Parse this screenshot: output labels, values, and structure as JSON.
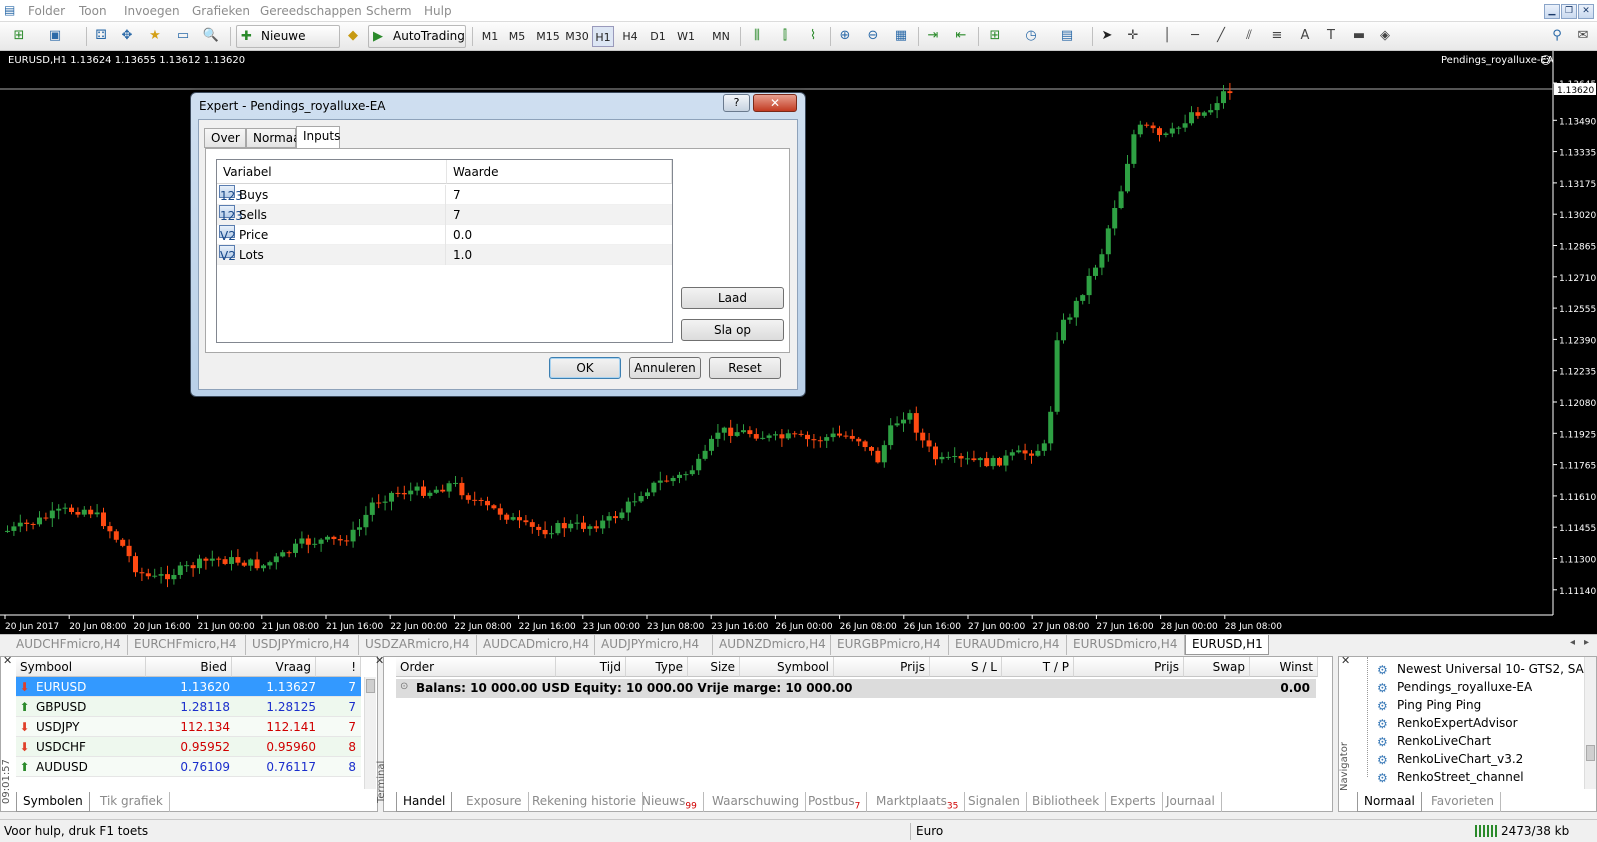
{
  "menu": [
    "Folder",
    "Toon",
    "Invoegen",
    "Grafieken",
    "Gereedschappen",
    "Scherm",
    "Hulp"
  ],
  "toolbar": {
    "new_order": "Nieuwe Order",
    "autotrading": "AutoTrading",
    "timeframes": [
      "M1",
      "M5",
      "M15",
      "M30",
      "H1",
      "H4",
      "D1",
      "W1",
      "MN"
    ]
  },
  "chart": {
    "header": "EURUSD,H1  1.13624 1.13655 1.13612 1.13620",
    "ea_label": "Pendings_royalluxe-EA",
    "current_price": "1.13620",
    "price_labels": [
      "1.13645",
      "1.13490",
      "1.13335",
      "1.13175",
      "1.13020",
      "1.12865",
      "1.12710",
      "1.12555",
      "1.12390",
      "1.12235",
      "1.12080",
      "1.11925",
      "1.11765",
      "1.11610",
      "1.11455",
      "1.11300",
      "1.11140"
    ],
    "time_labels": [
      "20 Jun 2017",
      "20 Jun 08:00",
      "20 Jun 16:00",
      "21 Jun 00:00",
      "21 Jun 08:00",
      "21 Jun 16:00",
      "22 Jun 00:00",
      "22 Jun 08:00",
      "22 Jun 16:00",
      "23 Jun 00:00",
      "23 Jun 08:00",
      "23 Jun 16:00",
      "26 Jun 00:00",
      "26 Jun 08:00",
      "26 Jun 16:00",
      "27 Jun 00:00",
      "27 Jun 08:00",
      "27 Jun 16:00",
      "28 Jun 00:00",
      "28 Jun 08:00"
    ],
    "colors": {
      "bull": "#2ea043",
      "bear": "#ff4a12",
      "background": "#000000",
      "grid": "#ffffff"
    }
  },
  "chart_tabs": [
    "AUDCHFmicro,H4",
    "EURCHFmicro,H4",
    "USDJPYmicro,H4",
    "USDZARmicro,H4",
    "AUDCADmicro,H4",
    "AUDJPYmicro,H4",
    "AUDNZDmicro,H4",
    "EURGBPmicro,H4",
    "EURAUDmicro,H4",
    "EURUSDmicro,H4",
    "EURUSD,H1"
  ],
  "dialog": {
    "title": "Expert - Pendings_royalluxe-EA",
    "help_btn": "?",
    "close_btn": "✕",
    "tabs": [
      "Over",
      "Normaal",
      "Inputs"
    ],
    "col_variable": "Variabel",
    "col_value": "Waarde",
    "rows": [
      {
        "icon": "123",
        "name": "Buys",
        "value": "7"
      },
      {
        "icon": "123",
        "name": "Sells",
        "value": "7"
      },
      {
        "icon": "V2",
        "name": "Price",
        "value": "0.0"
      },
      {
        "icon": "V2",
        "name": "Lots",
        "value": "1.0"
      }
    ],
    "load": "Laad",
    "save": "Sla op",
    "ok": "OK",
    "cancel": "Annuleren",
    "reset": "Reset"
  },
  "market_watch": {
    "headers": [
      "Symbool",
      "Bied",
      "Vraag",
      "!"
    ],
    "rows": [
      {
        "symbol": "EURUSD",
        "bid": "1.13620",
        "ask": "1.13627",
        "spread": "7",
        "dir": "down"
      },
      {
        "symbol": "GBPUSD",
        "bid": "1.28118",
        "ask": "1.28125",
        "spread": "7",
        "dir": "up"
      },
      {
        "symbol": "USDJPY",
        "bid": "112.134",
        "ask": "112.141",
        "spread": "7",
        "dir": "down"
      },
      {
        "symbol": "USDCHF",
        "bid": "0.95952",
        "ask": "0.95960",
        "spread": "8",
        "dir": "down"
      },
      {
        "symbol": "AUDUSD",
        "bid": "0.76109",
        "ask": "0.76117",
        "spread": "8",
        "dir": "up"
      }
    ],
    "time": "09:01:57",
    "tabs": [
      "Symbolen",
      "Tik grafiek"
    ]
  },
  "terminal": {
    "label": "Terminal",
    "headers": [
      "Order",
      "Tijd",
      "Type",
      "Size",
      "Symbool",
      "Prijs",
      "S / L",
      "T / P",
      "Prijs",
      "Swap",
      "Winst"
    ],
    "balance_text": "Balans: 10 000.00 USD  Equity: 10 000.00  Vrije marge: 10 000.00",
    "balance_profit": "0.00",
    "tabs": [
      {
        "label": "Handel",
        "badge": ""
      },
      {
        "label": "Exposure",
        "badge": ""
      },
      {
        "label": "Rekening historie",
        "badge": ""
      },
      {
        "label": "Nieuws",
        "badge": "99"
      },
      {
        "label": "Waarschuwing",
        "badge": ""
      },
      {
        "label": "Postbus",
        "badge": "7"
      },
      {
        "label": "Marktplaats",
        "badge": "35"
      },
      {
        "label": "Signalen",
        "badge": ""
      },
      {
        "label": "Bibliotheek",
        "badge": ""
      },
      {
        "label": "Experts",
        "badge": ""
      },
      {
        "label": "Journaal",
        "badge": ""
      }
    ]
  },
  "navigator": {
    "label": "Navigator",
    "items": [
      "Newest Universal 10- GTS2, SA",
      "Pendings_royalluxe-EA",
      "Ping Ping Ping",
      "RenkoExpertAdvisor",
      "RenkoLiveChart",
      "RenkoLiveChart_v3.2",
      "RenkoStreet_channel"
    ],
    "tabs": [
      "Normaal",
      "Favorieten"
    ]
  },
  "status": {
    "help": "Voor hulp, druk F1 toets",
    "profile": "Euro",
    "traffic": "2473/38 kb"
  }
}
